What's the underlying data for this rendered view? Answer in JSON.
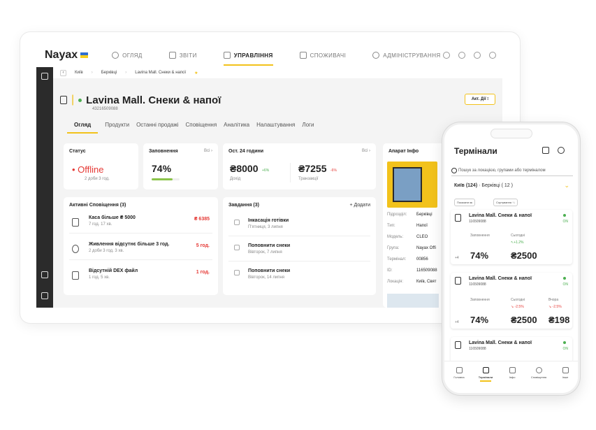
{
  "colors": {
    "accent": "#f2c21b",
    "danger": "#e53935",
    "online": "#4caf50"
  },
  "logo": "Nayax",
  "nav": [
    {
      "icon": "overview-icon",
      "label": "ОГЛЯД"
    },
    {
      "icon": "reports-icon",
      "label": "ЗВІТИ"
    },
    {
      "icon": "manage-icon",
      "label": "УПРАВЛІННЯ"
    },
    {
      "icon": "consumers-icon",
      "label": "СПОЖИВАЧІ"
    },
    {
      "icon": "admin-icon",
      "label": "АДМІНІСТРУВАННЯ"
    }
  ],
  "breadcrumb": [
    "Київ",
    "Берківці",
    "Lavina Mall. Снеки & напої"
  ],
  "device": {
    "name": "Lavina Mall. Снеки & напої",
    "serial": "43216509088",
    "action": "Акт. Дії"
  },
  "tabs": [
    "Огляд",
    "Продукти",
    "Останні продажі",
    "Сповіщення",
    "Аналітика",
    "Налаштування",
    "Логи"
  ],
  "status": {
    "title": "Статус",
    "value": "Offline",
    "sub": "2 доби 3 год."
  },
  "fill": {
    "title": "Заповнення",
    "all": "Всі",
    "value": "74%",
    "fraction": 0.74
  },
  "last24": {
    "title": "Ост. 24 години",
    "all": "Всі",
    "income": "₴8000",
    "income_change": "+6%",
    "income_label": "Дохід",
    "tx": "₴7255",
    "tx_change": "-6%",
    "tx_label": "Транзакції"
  },
  "machine": {
    "title": "Апарат Інфо",
    "fields": [
      {
        "label": "Підрозділ:",
        "value": "Берківці"
      },
      {
        "label": "Тип:",
        "value": "Напої"
      },
      {
        "label": "Модель:",
        "value": "CLEO"
      },
      {
        "label": "Група:",
        "value": "Nayax Offi"
      },
      {
        "label": "Термінал:",
        "value": "00856"
      },
      {
        "label": "ID:",
        "value": "116509088"
      },
      {
        "label": "Локація:",
        "value": "Київ, Свят"
      }
    ]
  },
  "alerts": {
    "title": "Активні Сповіщення (3)",
    "items": [
      {
        "title": "Каса більше ₴ 5000",
        "sub": "7 год. 17 хв.",
        "value": "₴ 6385"
      },
      {
        "title": "Живлення відсутнє більше 3 год.",
        "sub": "2 доби 3 год. 3 хв.",
        "value": "5 год."
      },
      {
        "title": "Відсутній DEX файл",
        "sub": "1 год. 5 хв.",
        "value": "1 год."
      }
    ]
  },
  "tasks": {
    "title": "Завдання (3)",
    "add": "+ Додати",
    "items": [
      {
        "title": "Інкасація готівки",
        "sub": "П'ятниця, 3 липня"
      },
      {
        "title": "Поповнити снеки",
        "sub": "Вівторок, 7 липня"
      },
      {
        "title": "Поповнити снеки",
        "sub": "Вівторок, 14 липня"
      }
    ]
  },
  "phone": {
    "title": "Термінали",
    "search": "Пошук за локацією, групами або терміналом",
    "loc_city": "Київ",
    "loc_city_count": "(124)",
    "loc_sub": "Берківці",
    "loc_sub_count": "( 12 )",
    "show_as": "Показати як",
    "sort": "Сортування ↑↓",
    "cards": [
      {
        "name": "Lavina Mall. Снеки & напої",
        "serial": "116509088",
        "status": "ON",
        "fill_label": "Заповнення",
        "fill": "74%",
        "today_label": "Сьогодні",
        "today_change": "↖+1.2%",
        "today": "₴2500",
        "extra_label": "",
        "extra_change": "",
        "extra": "",
        "more": "+4"
      },
      {
        "name": "Lavina Mall. Снеки & напої",
        "serial": "116509088",
        "status": "ON",
        "fill_label": "Заповнення",
        "fill": "74%",
        "today_label": "Сьогодні",
        "today_change": "↘ -2.5%",
        "today": "₴2500",
        "extra_label": "Вчора",
        "extra_change": "↘ -2.5%",
        "extra": "₴198",
        "more": "+4"
      },
      {
        "name": "Lavina Mall. Снеки & напої",
        "serial": "116509088",
        "status": "ON"
      }
    ],
    "tabbar": [
      "Головна",
      "Термінали",
      "Інфо",
      "Сповіщення",
      "Інше"
    ]
  }
}
